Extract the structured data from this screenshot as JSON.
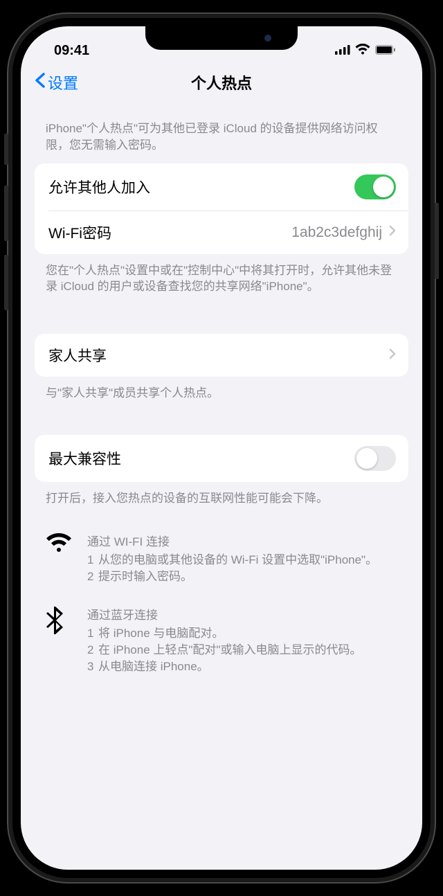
{
  "status": {
    "time": "09:41"
  },
  "nav": {
    "back": "设置",
    "title": "个人热点"
  },
  "intro": "iPhone\"个人热点\"可为其他已登录 iCloud 的设备提供网络访问权限，您无需输入密码。",
  "allowOthers": {
    "label": "允许其他人加入",
    "on": true
  },
  "wifiPassword": {
    "label": "Wi-Fi密码",
    "value": "1ab2c3defghij"
  },
  "allowFooter": "您在\"个人热点\"设置中或在\"控制中心\"中将其打开时，允许其他未登录 iCloud 的用户或设备查找您的共享网络\"iPhone\"。",
  "familySharing": {
    "label": "家人共享"
  },
  "familyFooter": "与\"家人共享\"成员共享个人热点。",
  "maxCompat": {
    "label": "最大兼容性",
    "on": false
  },
  "maxCompatFooter": "打开后，接入您热点的设备的互联网性能可能会下降。",
  "instructions": {
    "wifi": {
      "title": "通过 WI-FI 连接",
      "steps": [
        "从您的电脑或其他设备的 Wi-Fi 设置中选取\"iPhone\"。",
        "提示时输入密码。"
      ]
    },
    "bluetooth": {
      "title": "通过蓝牙连接",
      "steps": [
        "将 iPhone 与电脑配对。",
        "在 iPhone 上轻点\"配对\"或输入电脑上显示的代码。",
        "从电脑连接 iPhone。"
      ]
    }
  }
}
